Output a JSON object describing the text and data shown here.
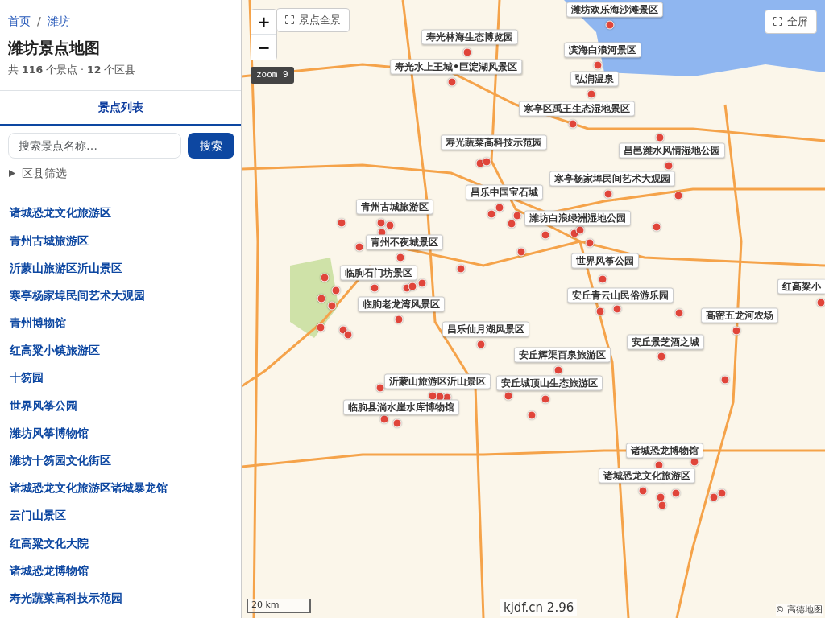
{
  "breadcrumb": [
    {
      "label": "首页"
    },
    {
      "label": "潍坊"
    }
  ],
  "breadcrumb_separator": "/",
  "title": "潍坊景点地图",
  "summary": "共 **116** 个景点 · **12** 个区县",
  "tabs": [
    {
      "label": "景点列表",
      "selected": true
    }
  ],
  "search": {
    "placeholder": "搜索景点名称…",
    "button": "搜索"
  },
  "filter": {
    "label": "区县筛选",
    "expanded": false
  },
  "spots": [
    "诸城恐龙文化旅游区",
    "青州古城旅游区",
    "沂蒙山旅游区沂山景区",
    "寒亭杨家埠民间艺术大观园",
    "青州博物馆",
    "红高粱小镇旅游区",
    "十笏园",
    "世界风筝公园",
    "潍坊风筝博物馆",
    "潍坊十笏园文化街区",
    "诸城恐龙文化旅游区诸城暴龙馆",
    "云门山景区",
    "红高粱文化大院",
    "诸城恐龙博物馆",
    "寿光蔬菜高科技示范园"
  ],
  "map": {
    "zoom_in": "+",
    "zoom_out": "−",
    "fit_button": "景点全景",
    "zoom_badge": "zoom 9",
    "fullscreen_button": "全屏",
    "labels": [
      "潍坊欢乐海沙滩景区",
      "寿光林海生态博览园",
      "滨海白浪河景区",
      "寿光水上王城•巨淀湖风景区",
      "弘润温泉",
      "寒亭区禹王生态湿地景区",
      "寿光蔬菜高科技示范园",
      "昌邑潍水风情湿地公园",
      "寒亭杨家埠民间艺术大观园",
      "昌乐中国宝石城",
      "青州古城旅游区",
      "潍坊白浪绿洲湿地公园",
      "青州不夜城景区",
      "世界风筝公园",
      "临朐石门坊景区",
      "安丘青云山民俗游乐园",
      "红高粱小",
      "临朐老龙湾风景区",
      "高密五龙河农场",
      "昌乐仙月湖风景区",
      "安丘景芝酒之城",
      "安丘辉渠百泉旅游区",
      "沂蒙山旅游区沂山景区",
      "安丘城顶山生态旅游区",
      "临朐县淌水崖水库博物馆",
      "诸城恐龙博物馆",
      "诸城恐龙文化旅游区"
    ],
    "scale": "20 km",
    "footer": "kjdf.cn 2.96",
    "attribution": "© 高德地图"
  }
}
